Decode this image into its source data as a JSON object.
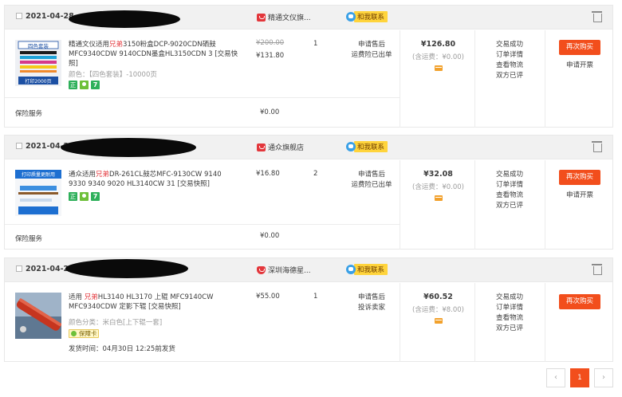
{
  "orders": [
    {
      "date": "2021-04-28",
      "shop_name": "精通文仪旗...",
      "contact_label": "和我联系",
      "product_title_pre": "精通文仪适用",
      "product_title_brand": "兄弟",
      "product_title_post": "3150粉盒DCP-9020CDN硒鼓MFC9340CDW 9140CDN墨盒HL3150CDN 3 [交易快照]",
      "thumb_label_top": "四色套装",
      "thumb_label_bottom": "打印2000页",
      "spec_label": "颜色：",
      "spec_value": "【四色套装】-10000页",
      "price_original": "¥200.00",
      "price_current": "¥131.80",
      "quantity": "1",
      "after_sale_1": "申请售后",
      "after_sale_2": "运费险已出单",
      "total": "¥126.80",
      "freight": "(含运费：¥0.00)",
      "status_lines": [
        "交易成功",
        "订单详情",
        "查看物流",
        "双方已评"
      ],
      "rebuy_label": "再次购买",
      "invoice_label": "申请开票",
      "insurance_label": "保险服务",
      "insurance_price": "¥0.00"
    },
    {
      "date": "2021-04-2",
      "shop_name": "通众旗舰店",
      "contact_label": "和我联系",
      "product_title_pre": "通众适用",
      "product_title_brand": "兄弟",
      "product_title_post": "DR-261CL鼓芯MFC-9130CW 9140 9330 9340 9020 HL3140CW 31 [交易快照]",
      "thumb_label_top": "打印质量更耐用",
      "thumb_label_bottom": "",
      "spec_label": "",
      "spec_value": "",
      "price_original": "",
      "price_current": "¥16.80",
      "quantity": "2",
      "after_sale_1": "申请售后",
      "after_sale_2": "运费险已出单",
      "total": "¥32.08",
      "freight": "(含运费：¥0.00)",
      "status_lines": [
        "交易成功",
        "订单详情",
        "查看物流",
        "双方已评"
      ],
      "rebuy_label": "再次购买",
      "invoice_label": "申请开票",
      "insurance_label": "保险服务",
      "insurance_price": "¥0.00"
    },
    {
      "date": "2021-04-28",
      "shop_name": "深圳海德星...",
      "contact_label": "和我联系",
      "product_title_pre": "适用 ",
      "product_title_brand": "兄弟",
      "product_title_post": "HL3140 HL3170 上辊 MFC9140CW MFC9340CDW 定影下辊 [交易快照]",
      "thumb_label_top": "",
      "thumb_label_bottom": "",
      "spec_label": "颜色分类：",
      "spec_value": "米白色[上下辊一套]",
      "guarantee_label": "保障卡",
      "ship_label": "发货时间：",
      "ship_value": "04月30日 12:25前发货",
      "price_original": "",
      "price_current": "¥55.00",
      "quantity": "1",
      "after_sale_1": "申请售后",
      "after_sale_2": "投诉卖家",
      "total": "¥60.52",
      "freight": "(含运费：¥8.00)",
      "status_lines": [
        "交易成功",
        "订单详情",
        "查看物流",
        "双方已评"
      ],
      "rebuy_label": "再次购买"
    }
  ],
  "badges": {
    "zheng": "正",
    "seven": "7"
  },
  "pagination": {
    "prev": "‹",
    "current": "1",
    "next": "›"
  },
  "colors": {
    "accent": "#f24e1c",
    "brand_red": "#e3363b",
    "header_bg": "#f1f1f1"
  }
}
